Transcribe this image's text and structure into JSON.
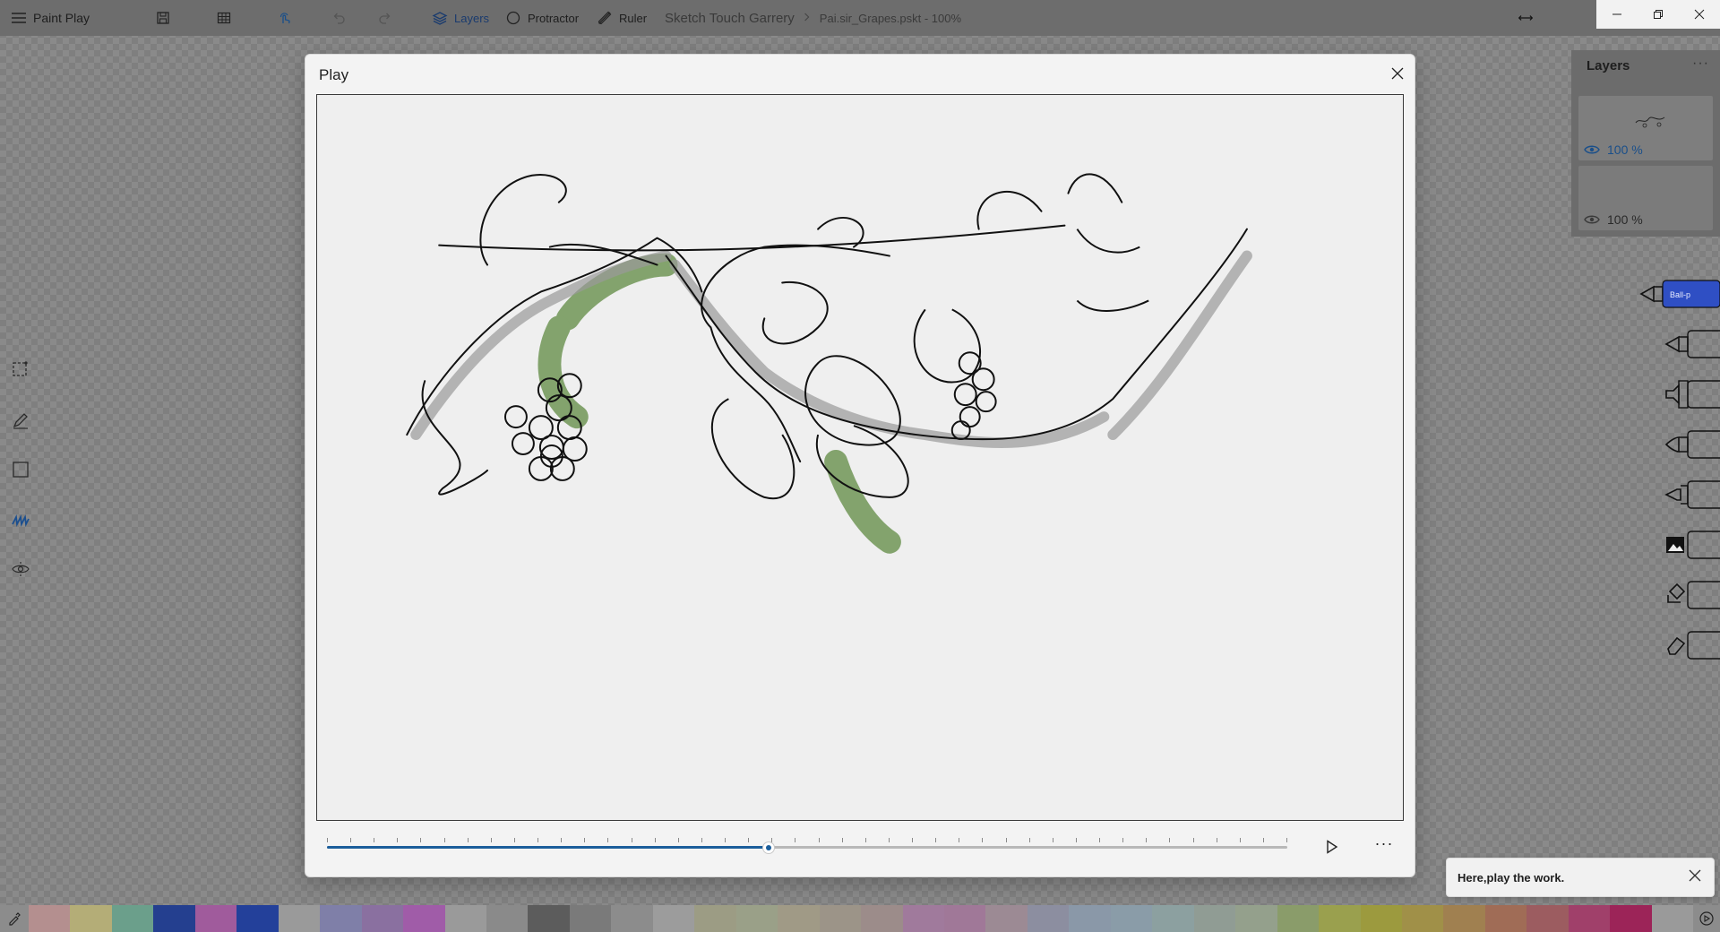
{
  "app": {
    "name": "Paint Play"
  },
  "toolbar": {
    "layers_label": "Layers",
    "protractor_label": "Protractor",
    "ruler_label": "Ruler"
  },
  "breadcrumb": {
    "folder": "Sketch Touch Garrery",
    "file": "Pai.sir_Grapes.pskt - 100%"
  },
  "layers": {
    "title": "Layers",
    "more": "···",
    "items": [
      {
        "opacity": "100 %",
        "active": true
      },
      {
        "opacity": "100 %",
        "active": false
      }
    ]
  },
  "right_tools": [
    {
      "icon": "ballpoint-pen-icon",
      "label": "Ball-p",
      "selected": true
    },
    {
      "icon": "pencil-tool-icon"
    },
    {
      "icon": "marker-tool-icon"
    },
    {
      "icon": "fountain-pen-icon"
    },
    {
      "icon": "brush-tool-icon"
    },
    {
      "icon": "image-tool-icon"
    },
    {
      "icon": "fill-bucket-icon"
    },
    {
      "icon": "eraser-tool-icon"
    }
  ],
  "dialog": {
    "title": "Play",
    "more": "···",
    "progress": 0.46
  },
  "toast": {
    "text": "Here,play the work."
  },
  "palette": [
    "#b48f8f",
    "#b4ad77",
    "#6b9f8b",
    "#243f8f",
    "#a05b9c",
    "#23409a",
    "#9a9a9a",
    "#7f7fa8",
    "#8a70a0",
    "#a05ca8",
    "#9a9a9a",
    "#8a8a8a",
    "#5c5c5c",
    "#7a7a7a",
    "#8c8c8c",
    "#9c9c9c",
    "#9c9c84",
    "#9aa088",
    "#a09a86",
    "#9c9488",
    "#9c8c8a",
    "#a07a9c",
    "#a07898",
    "#9c8a94",
    "#8c8ea0",
    "#8a98a8",
    "#8a9ca8",
    "#8ca0a0",
    "#909c94",
    "#94a08c",
    "#8a9c6a",
    "#9aa04e",
    "#9c9a3e",
    "#a09048",
    "#a08050",
    "#a06c56",
    "#9c5c60",
    "#a0406a",
    "#9c2458",
    "#9a9a9a"
  ]
}
